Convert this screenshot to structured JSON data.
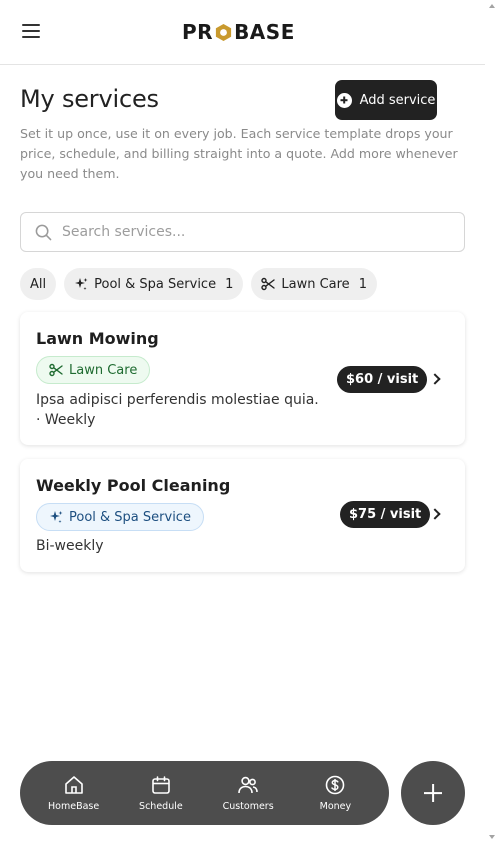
{
  "header": {
    "logo_text_left": "PR",
    "logo_text_right": "BASE",
    "logo_colors": {
      "hex": "#c99a2e",
      "text": "#1a1a1a"
    }
  },
  "page": {
    "title": "My services",
    "add_button_label": "Add service",
    "intro": "Set it up once, use it on every job. Each service template drops your price, schedule, and billing straight into a quote. Add more whenever you need them."
  },
  "search": {
    "placeholder": "Search services..."
  },
  "filters": [
    {
      "label": "All",
      "icon": ""
    },
    {
      "label": "Pool & Spa Service",
      "count": "1",
      "icon": "sparkle-icon"
    },
    {
      "label": "Lawn Care",
      "count": "1",
      "icon": "scissors-icon"
    }
  ],
  "services": [
    {
      "title": "Lawn Mowing",
      "category": "Lawn Care",
      "category_icon": "scissors-icon",
      "description_line1": "Ipsa adipisci perferendis molestiae quia.",
      "description_line2": "· Weekly",
      "price": "$60 / visit"
    },
    {
      "title": "Weekly Pool Cleaning",
      "category": "Pool & Spa Service",
      "category_icon": "sparkle-icon",
      "description_line1": "Bi-weekly",
      "price": "$75 / visit"
    }
  ],
  "bottom_nav": [
    {
      "label": "HomeBase",
      "icon": "home-icon"
    },
    {
      "label": "Schedule",
      "icon": "calendar-icon"
    },
    {
      "label": "Customers",
      "icon": "users-icon"
    },
    {
      "label": "Money",
      "icon": "dollar-icon"
    }
  ],
  "colors": {
    "primary_dark": "#222222",
    "nav_bg": "#4d4d4d",
    "lawn_chip_bg": "#eefaf0",
    "pool_chip_bg": "#eef6fd"
  }
}
